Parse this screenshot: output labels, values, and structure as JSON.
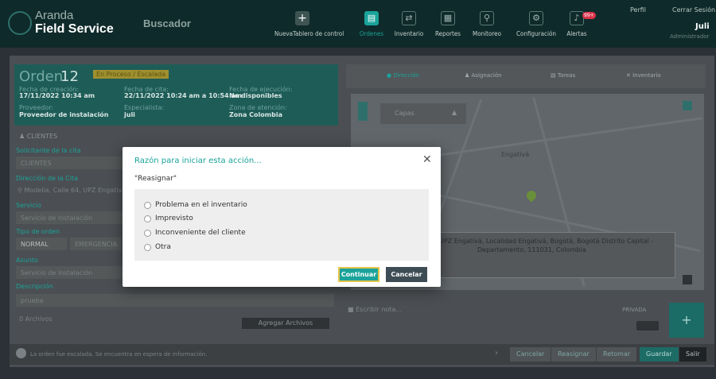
{
  "brand": {
    "line1": "Aranda",
    "line2": "Field Service"
  },
  "header": {
    "search_label": "Buscador",
    "nav": [
      {
        "label": "NuevaTablero de control",
        "icon": "plus-icon"
      },
      {
        "label": "Ordenes",
        "icon": "orders-icon"
      },
      {
        "label": "Inventario",
        "icon": "inventory-icon"
      },
      {
        "label": "Reportes",
        "icon": "reports-icon"
      },
      {
        "label": "Monitoreo",
        "icon": "monitor-icon"
      },
      {
        "label": "Configuración",
        "icon": "gear-icon"
      },
      {
        "label": "Alertas",
        "icon": "bell-icon"
      }
    ],
    "alert_count": "99+",
    "profile_link": "Perfil",
    "logout_link": "Cerrar Sesión",
    "user_name": "Juli",
    "user_role": "Administrador"
  },
  "order": {
    "title": "Orden",
    "number": "12",
    "status": "En Proceso / Escalada",
    "created_label": "Fecha de creación:",
    "created_value": "17/11/2022 10:34 am",
    "appointment_label": "Fecha de cita:",
    "appointment_value": "22/11/2022 10:24 am a 10:54 am",
    "execution_label": "Fecha de ejecución:",
    "execution_value": "No disponibles",
    "provider_label": "Proveedor:",
    "provider_value": "Proveedor de instalación",
    "specialist_label": "Especialista:",
    "specialist_value": "juli",
    "zone_label": "Zona de atención:",
    "zone_value": "Zona Colombia"
  },
  "left_form": {
    "clients_header": "CLIENTES",
    "requester_label": "Solicitante de la cita",
    "requester_value": "CLIENTES",
    "address_label": "Dirección de la Cita",
    "address_value": "Modelia, Calle 64, UPZ Engativá",
    "service_label": "Servicio",
    "service_value": "Servicio de Instalación",
    "order_type_label": "Tipo de orden",
    "type_normal": "NORMAL",
    "type_emergency": "EMERGENCIA",
    "subject_label": "Asunto",
    "subject_value": "Servicio de Instalación",
    "description_label": "Descripción",
    "description_value": "prueba",
    "files_label": "0 Archivos",
    "add_files": "Agregar Archivos"
  },
  "right_tabs": [
    "Dirección",
    "Asignación",
    "Tareas",
    "Inventario"
  ],
  "map": {
    "layers_label": "Capas",
    "place_label": "Engativá",
    "address_popup_line1": "UPZ Engativá, Localidad Engativá, Bogotá, Bogotá Distrito Capital -",
    "address_popup_line2": "Departamento, 111031, Colombia"
  },
  "chat": {
    "placeholder": "Escribir nota...",
    "private_label": "PRIVADA"
  },
  "footer": {
    "message": "La orden fue escalada. Se encuentra en espera de información.",
    "buttons": [
      "Cancelar",
      "Reasignar",
      "Retomar",
      "Guardar",
      "Salir"
    ]
  },
  "modal": {
    "title": "Razón para iniciar esta acción...",
    "action": "\"Reasignar\"",
    "options": [
      "Problema en el inventario",
      "Imprevisto",
      "Inconveniente del cliente",
      "Otra"
    ],
    "continue_label": "Continuar",
    "cancel_label": "Cancelar"
  },
  "colors": {
    "accent": "#1aa39a",
    "header_bg": "#0f2a2a",
    "modal_bg": "#ffffff",
    "danger": "#d9334a"
  }
}
